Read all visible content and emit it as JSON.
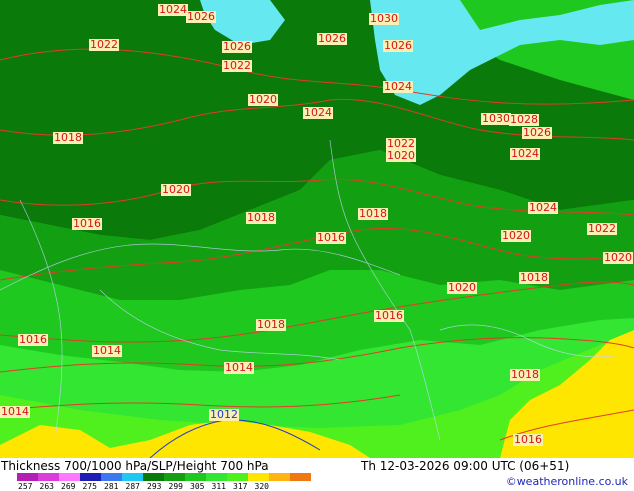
{
  "map": {
    "colors": {
      "sea": "#66e8f0",
      "dark_green": "#0a7a0a",
      "mid_green": "#12a012",
      "green": "#1ec81e",
      "bright_green": "#32e632",
      "lime": "#50f01e",
      "yellow": "#ffe600",
      "orange": "#ffb414",
      "isobar": "#e03c28",
      "thickness_line_blue": "#1e3cc8"
    },
    "isobar_labels": [
      "1024",
      "1026",
      "1030",
      "1022",
      "1026",
      "1026",
      "1026",
      "1022",
      "1024",
      "1020",
      "1024",
      "1030",
      "1028",
      "1026",
      "1018",
      "1022",
      "1020",
      "1024",
      "1020",
      "1024",
      "1018",
      "1018",
      "1016",
      "1016",
      "1022",
      "1020",
      "1020",
      "1018",
      "1020",
      "1016",
      "1016",
      "1014",
      "1018",
      "1014",
      "1014",
      "1012",
      "1018",
      "1016"
    ]
  },
  "footer": {
    "title": "Thickness 700/1000 hPa/SLP/Height 700 hPa",
    "datetime": "Th 12-03-2026 09:00 UTC (06+51)",
    "credit": "©weatheronline.co.uk",
    "scale_values": [
      "257",
      "263",
      "269",
      "275",
      "281",
      "287",
      "293",
      "299",
      "305",
      "311",
      "317",
      "320"
    ],
    "scale_colors": [
      "#b41eb4",
      "#dc3cdc",
      "#ff78ff",
      "#1e1eb4",
      "#3c78f0",
      "#1ec8f0",
      "#0a7a0a",
      "#12a012",
      "#1ec81e",
      "#32e632",
      "#50f01e",
      "#ffe600",
      "#ffb414",
      "#f07814"
    ]
  }
}
